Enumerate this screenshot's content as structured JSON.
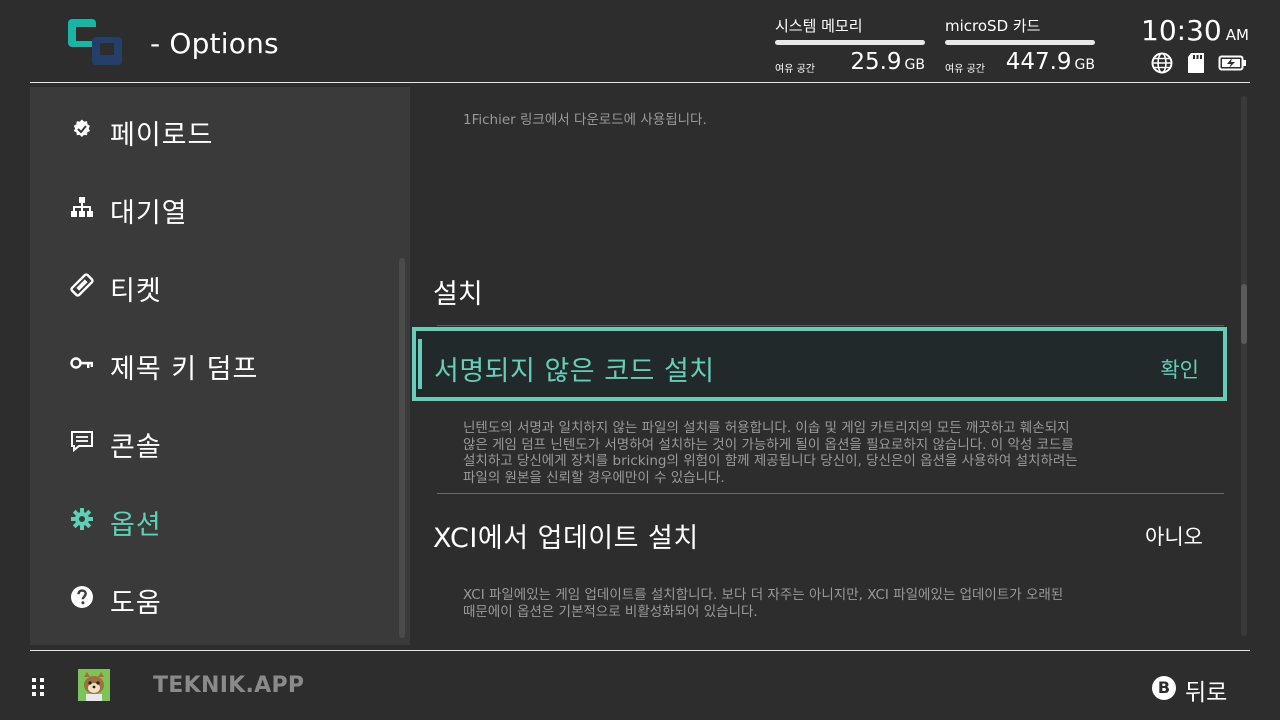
{
  "header": {
    "logo": "teknik-logo",
    "title": "- Options",
    "storage": [
      {
        "label": "시스템 메모리",
        "free_label": "여유 공간",
        "free_value": "25.9",
        "unit": "GB"
      },
      {
        "label": "microSD 카드",
        "free_label": "여유 공간",
        "free_value": "447.9",
        "unit": "GB"
      }
    ],
    "clock": {
      "time": "10:30",
      "ampm": "AM"
    },
    "status_icons": [
      "globe-icon",
      "sd-card-icon",
      "battery-charging-icon"
    ]
  },
  "sidebar": {
    "items": [
      {
        "label": "페이로드",
        "icon": "badge-icon",
        "active": false
      },
      {
        "label": "대기열",
        "icon": "hierarchy-icon",
        "active": false
      },
      {
        "label": "티켓",
        "icon": "ticket-icon",
        "active": false
      },
      {
        "label": "제목 키 덤프",
        "icon": "key-icon",
        "active": false
      },
      {
        "label": "콘솔",
        "icon": "console-icon",
        "active": false
      },
      {
        "label": "옵션",
        "icon": "gear-icon",
        "active": true
      },
      {
        "label": "도움",
        "icon": "help-icon",
        "active": false
      }
    ]
  },
  "content": {
    "top_description": "1Fichier 링크에서 다운로드에 사용됩니다.",
    "section_title": "설치",
    "settings": [
      {
        "label": "서명되지 않은 코드 설치",
        "value": "확인",
        "selected": true,
        "description": [
          "닌텐도의 서명과 일치하지 않는 파일의 설치를 허용합니다. 이솝 및 게임 카트리지의 모든 깨끗하고 훼손되지",
          "않은 게임 덤프 닌텐도가 서명하여 설치하는 것이 가능하게 될이 옵션을 필요로하지 않습니다. 이 악성 코드를",
          "설치하고 당신에게 장치를 bricking의 위험이 함께 제공됩니다 당신이, 당신은이 옵션을 사용하여 설치하려는",
          "파일의 원본을 신뢰할 경우에만이 수 있습니다."
        ]
      },
      {
        "label": "XCI에서 업데이트 설치",
        "value": "아니오",
        "selected": false,
        "description": [
          "XCI 파일에있는 게임 업데이트를 설치합니다. 보다 더 자주는 아니지만, XCI 파일에있는 업데이트가 오래된",
          "때문에이 옵션은 기본적으로 비활성화되어 있습니다."
        ]
      }
    ]
  },
  "footer": {
    "app_name": "TEKNIK.APP",
    "back_button": "B",
    "back_label": "뒤로"
  },
  "colors": {
    "accent": "#67cdb8",
    "background": "#2d2d2d",
    "sidebar": "#3a3a3a"
  }
}
